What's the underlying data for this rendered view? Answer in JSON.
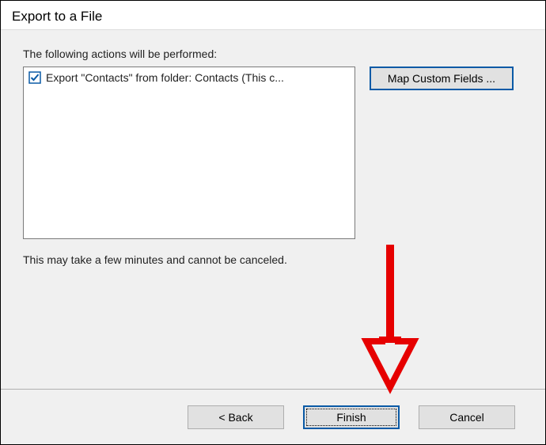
{
  "title": "Export to a File",
  "content": {
    "prompt": "The following actions will be performed:",
    "actions": [
      {
        "checked": true,
        "label": "Export \"Contacts\" from folder: Contacts (This c..."
      }
    ],
    "map_button": "Map Custom Fields ...",
    "note": "This may take a few minutes and cannot be canceled."
  },
  "buttons": {
    "back": "< Back",
    "finish": "Finish",
    "cancel": "Cancel"
  },
  "colors": {
    "accent": "#0a5aa6",
    "arrow": "#e60000"
  }
}
